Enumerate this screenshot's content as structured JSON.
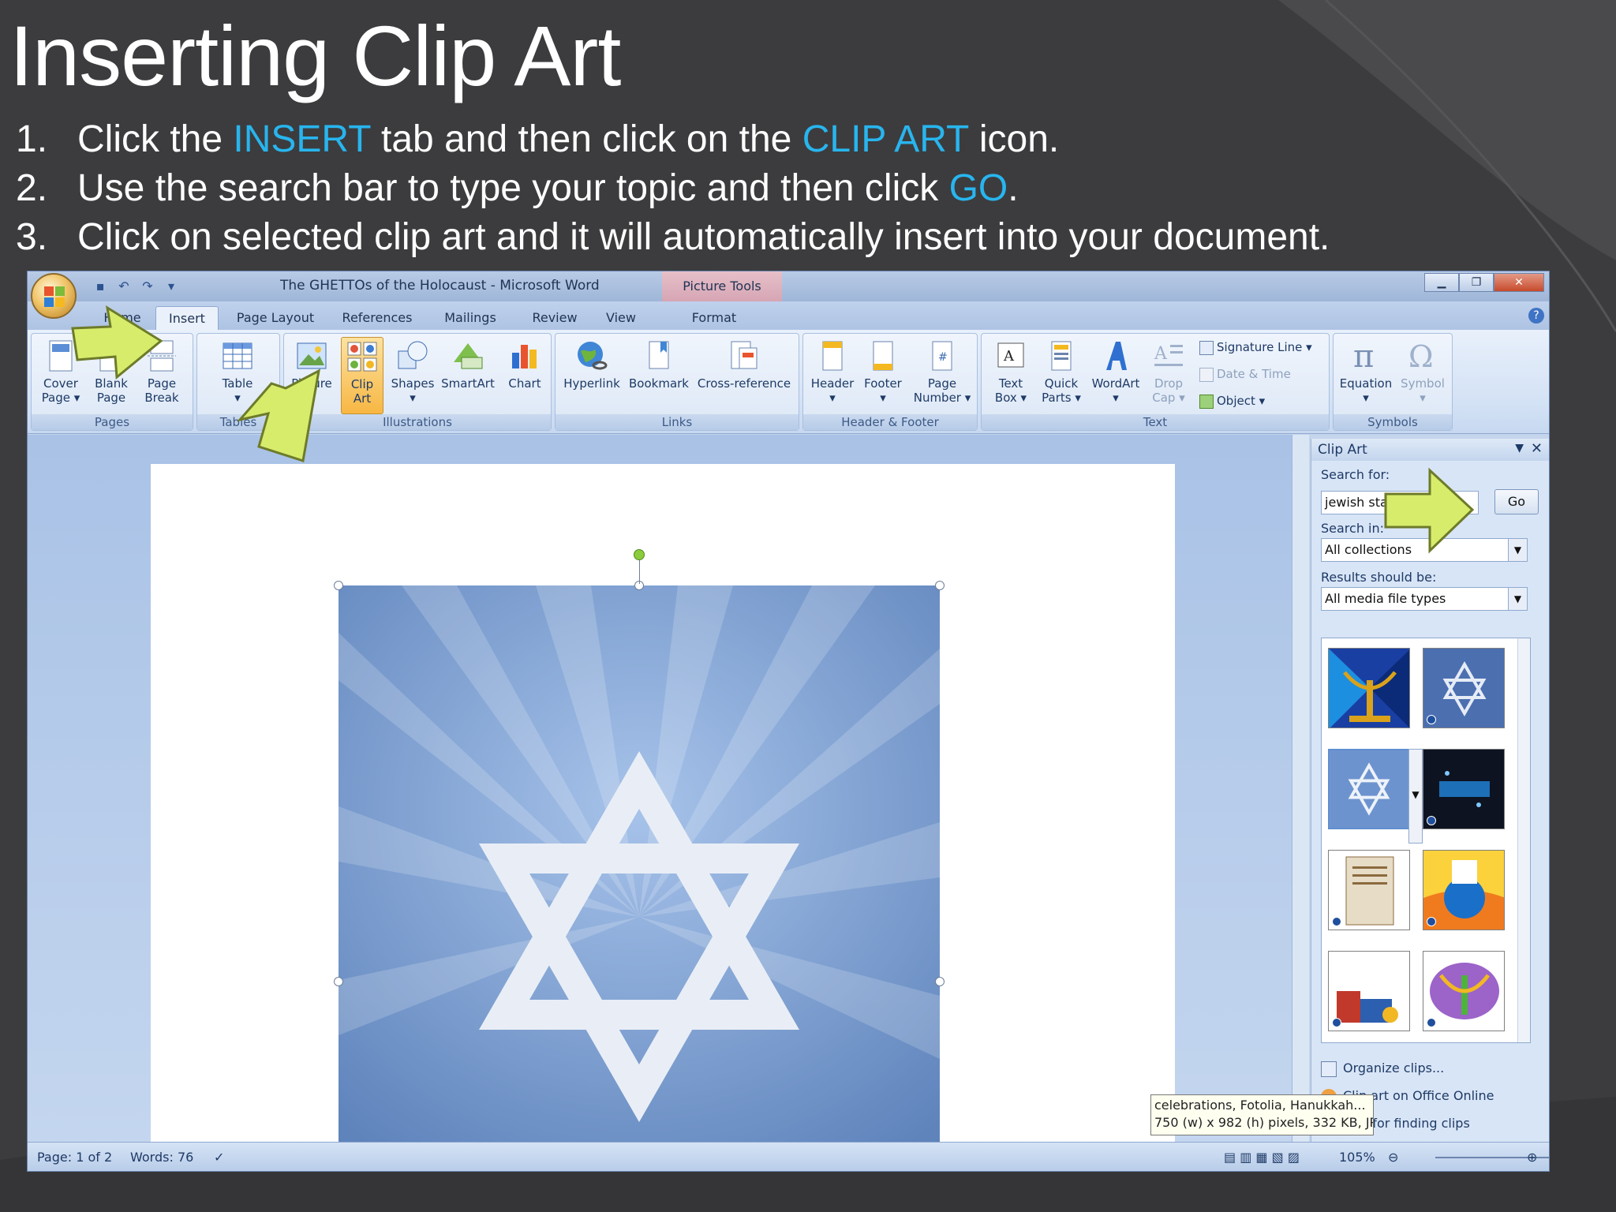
{
  "slide": {
    "title": "Inserting Clip Art",
    "steps": [
      {
        "num": "1.",
        "parts": [
          "Click the ",
          "INSERT",
          " tab and then click on the ",
          "CLIP ART",
          " icon."
        ]
      },
      {
        "num": "2.",
        "parts": [
          "Use the search bar to type your topic and then click ",
          "GO",
          "."
        ]
      },
      {
        "num": "3.",
        "parts": [
          "Click on selected clip art and it will automatically insert into your document."
        ]
      }
    ],
    "highlight_color": "#28b5ee"
  },
  "word": {
    "window_title": "The GHETTOs of the Holocaust - Microsoft Word",
    "context_tab_title": "Picture Tools",
    "tabs": [
      "Home",
      "Insert",
      "Page Layout",
      "References",
      "Mailings",
      "Review",
      "View",
      "Format"
    ],
    "active_tab": "Insert",
    "ribbon": {
      "pages": {
        "label": "Pages",
        "buttons": [
          [
            "Cover",
            "Page ▾"
          ],
          [
            "Blank",
            "Page"
          ],
          [
            "Page",
            "Break"
          ]
        ]
      },
      "tables": {
        "label": "Tables",
        "buttons": [
          [
            "Table",
            "▾"
          ]
        ]
      },
      "illustrations": {
        "label": "Illustrations",
        "buttons": [
          [
            "Picture",
            ""
          ],
          [
            "Clip",
            "Art"
          ],
          [
            "Shapes",
            "▾"
          ],
          [
            "SmartArt",
            ""
          ],
          [
            "Chart",
            ""
          ]
        ]
      },
      "links": {
        "label": "Links",
        "buttons": [
          [
            "Hyperlink",
            ""
          ],
          [
            "Bookmark",
            ""
          ],
          [
            "Cross-reference",
            ""
          ]
        ]
      },
      "header_footer": {
        "label": "Header & Footer",
        "buttons": [
          [
            "Header",
            "▾"
          ],
          [
            "Footer",
            "▾"
          ],
          [
            "Page",
            "Number ▾"
          ]
        ]
      },
      "text": {
        "label": "Text",
        "buttons": [
          [
            "Text",
            "Box ▾"
          ],
          [
            "Quick",
            "Parts ▾"
          ],
          [
            "WordArt",
            "▾"
          ],
          [
            "Drop",
            "Cap ▾"
          ]
        ],
        "small": [
          "Signature Line ▾",
          "Date & Time",
          "Object ▾"
        ]
      },
      "symbols": {
        "label": "Symbols",
        "buttons": [
          [
            "Equation",
            "▾"
          ],
          [
            "Symbol",
            "▾"
          ]
        ]
      }
    },
    "clip_art_pane": {
      "title": "Clip Art",
      "search_for_label": "Search for:",
      "search_value": "jewish star",
      "go_label": "Go",
      "search_in_label": "Search in:",
      "search_in_value": "All collections",
      "results_label": "Results should be:",
      "results_value": "All media file types",
      "links": [
        "Organize clips...",
        "Clip art on Office Online",
        "Tips for finding clips"
      ]
    },
    "tooltip": {
      "line1": "celebrations, Fotolia, Hanukkah...",
      "line2": "750 (w) x 982 (h) pixels, 332 KB, JPG"
    },
    "status": {
      "page": "Page: 1 of 2",
      "words": "Words: 76",
      "zoom": "105%"
    }
  }
}
